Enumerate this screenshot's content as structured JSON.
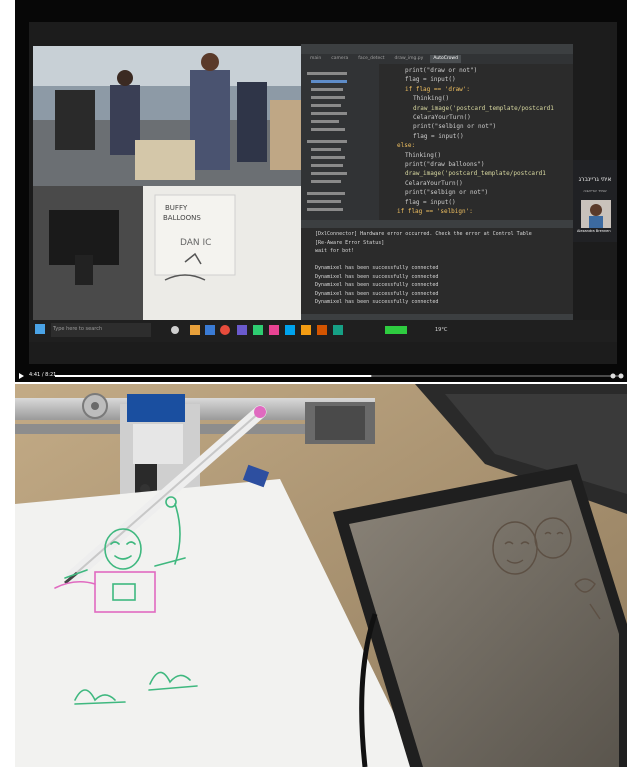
{
  "video": {
    "time": "4:41 / 8:21"
  },
  "ide": {
    "tabs": [
      "main",
      "camera",
      "face_detect",
      "draw_img.py",
      "AutoCrowd"
    ],
    "code_lines": [
      {
        "text": "print(\"draw or not\")",
        "indent": 3,
        "color": "#cfcfcf"
      },
      {
        "text": "flag = input()",
        "indent": 3,
        "color": "#cfcfcf"
      },
      {
        "text": "if flag == 'draw':",
        "indent": 3,
        "color": "#f0c060"
      },
      {
        "text": "Thinking()",
        "indent": 4,
        "color": "#cfcfcf"
      },
      {
        "text": "draw_image('postcard_template/postcard1",
        "indent": 4,
        "color": "#d8d8a0"
      },
      {
        "text": "CelaraYourTurn()",
        "indent": 4,
        "color": "#cfcfcf"
      },
      {
        "text": "print(\"selbign or not\")",
        "indent": 4,
        "color": "#cfcfcf"
      },
      {
        "text": "flag = input()",
        "indent": 4,
        "color": "#cfcfcf"
      },
      {
        "text": "else:",
        "indent": 2,
        "color": "#f0c060"
      },
      {
        "text": "Thinking()",
        "indent": 3,
        "color": "#cfcfcf"
      },
      {
        "text": "print(\"draw balloons\")",
        "indent": 3,
        "color": "#cfcfcf"
      },
      {
        "text": "draw_image('postcard_template/postcard1",
        "indent": 3,
        "color": "#d8d8a0"
      },
      {
        "text": "CelaraYourTurn()",
        "indent": 3,
        "color": "#cfcfcf"
      },
      {
        "text": "print(\"selbign or not\")",
        "indent": 3,
        "color": "#cfcfcf"
      },
      {
        "text": "flag = input()",
        "indent": 3,
        "color": "#cfcfcf"
      },
      {
        "text": "if flag == 'selbign':",
        "indent": 2,
        "color": "#f0c060"
      }
    ],
    "console_lines": [
      "[DxlConnector] Hardware error occurred. Check the error at Control Table",
      "[Re-Aware Error Status]",
      "wait for bot!",
      "",
      "Dynamixel has been successfully connected",
      "Dynamixel has been successfully connected",
      "Dynamixel has been successfully connected",
      "Dynamixel has been successfully connected",
      "Dynamixel has been successfully connected"
    ]
  },
  "whiteboard": {
    "line1": "BUFFY",
    "line2": "BALLOONS",
    "line3": "DAN IC"
  },
  "taskbar": {
    "search_placeholder": "Type here to search",
    "temperature": "19°C"
  },
  "participant": {
    "name_heading": "איתי גריינברג",
    "subtitle": "אמיר אריאבה",
    "tile_name": "Alexandra Brennen"
  },
  "colors": {
    "ide_bg": "#2b2b2b",
    "progress": "#ffffff",
    "marker_green": "#3fb87f",
    "marker_pink": "#e06ac0"
  }
}
